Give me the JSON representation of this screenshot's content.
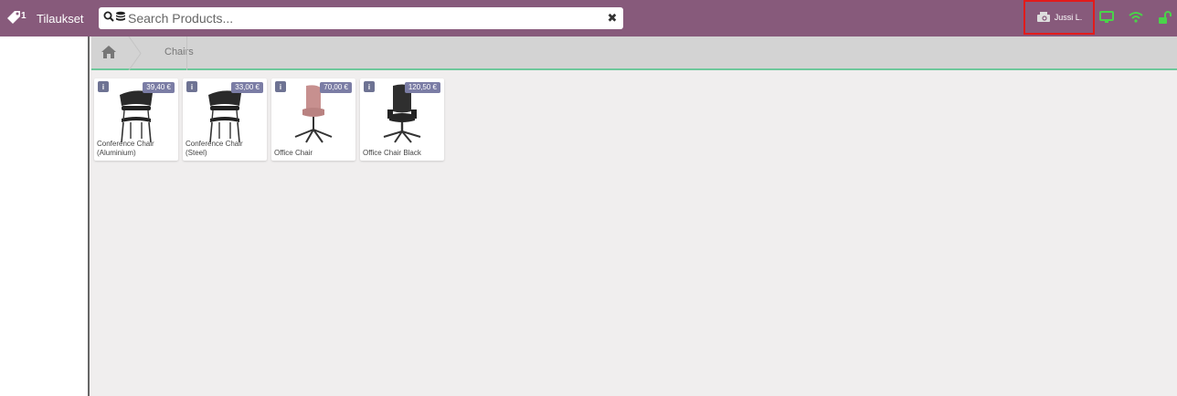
{
  "header": {
    "orders_label": "Tilaukset",
    "orders_count": "1",
    "search_placeholder": "Search Products...",
    "cashier_name": "Jussi L."
  },
  "breadcrumb": {
    "category": "Chairs"
  },
  "colors": {
    "topbar": "#875a7b",
    "status_green": "#4ad34a",
    "price_badge": "#7b7da5"
  },
  "products": [
    {
      "name": "Conference Chair (Aluminium)",
      "price": "39,40 €"
    },
    {
      "name": "Conference Chair (Steel)",
      "price": "33,00 €"
    },
    {
      "name": "Office Chair",
      "price": "70,00 €"
    },
    {
      "name": "Office Chair Black",
      "price": "120,50 €"
    }
  ]
}
